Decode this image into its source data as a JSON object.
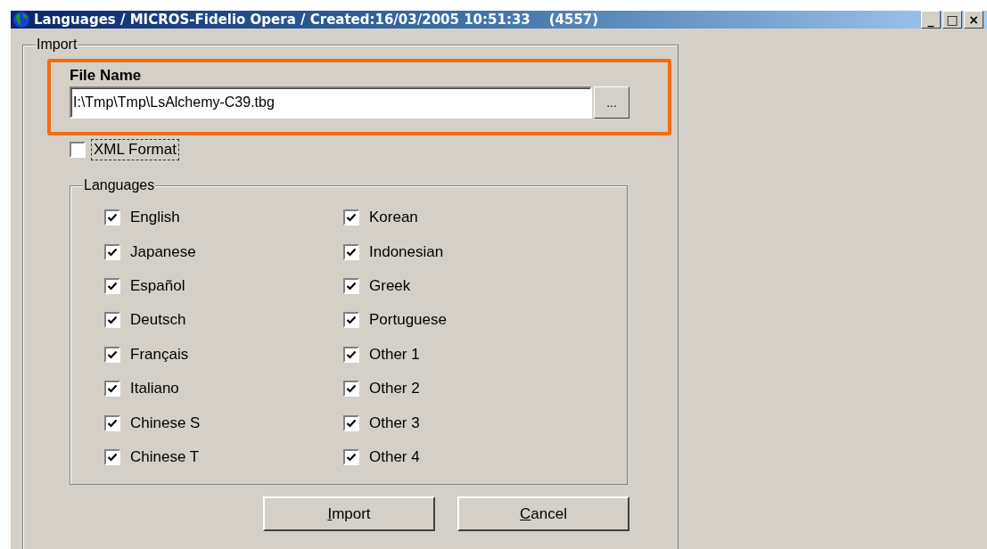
{
  "window": {
    "title": "Languages / MICROS-Fidelio Opera / Created:16/03/2005 10:51:33    (4557)",
    "controls": [
      "_",
      "□",
      "×"
    ]
  },
  "import_group": {
    "title": "Import",
    "file_name": {
      "label": "File Name",
      "value": "I:\\Tmp\\Tmp\\LsAlchemy-C39.tbg",
      "browse": "...",
      "highlighted": true
    },
    "xml_format": {
      "label": "XML Format",
      "checked": false,
      "focused": true
    },
    "languages": {
      "title": "Languages",
      "items": [
        {
          "label": "English",
          "checked": true
        },
        {
          "label": "Japanese",
          "checked": true
        },
        {
          "label": "Español",
          "checked": true
        },
        {
          "label": "Deutsch",
          "checked": true
        },
        {
          "label": "Français",
          "checked": true
        },
        {
          "label": "Italiano",
          "checked": true
        },
        {
          "label": "Chinese S",
          "checked": true
        },
        {
          "label": "Chinese T",
          "checked": true
        },
        {
          "label": "Korean",
          "checked": true
        },
        {
          "label": "Indonesian",
          "checked": true
        },
        {
          "label": "Greek",
          "checked": true
        },
        {
          "label": "Portuguese",
          "checked": true
        },
        {
          "label": "Other 1",
          "checked": true
        },
        {
          "label": "Other 2",
          "checked": true
        },
        {
          "label": "Other 3",
          "checked": true
        },
        {
          "label": "Other 4",
          "checked": true
        }
      ]
    },
    "buttons": [
      "Import",
      "Cancel"
    ]
  }
}
